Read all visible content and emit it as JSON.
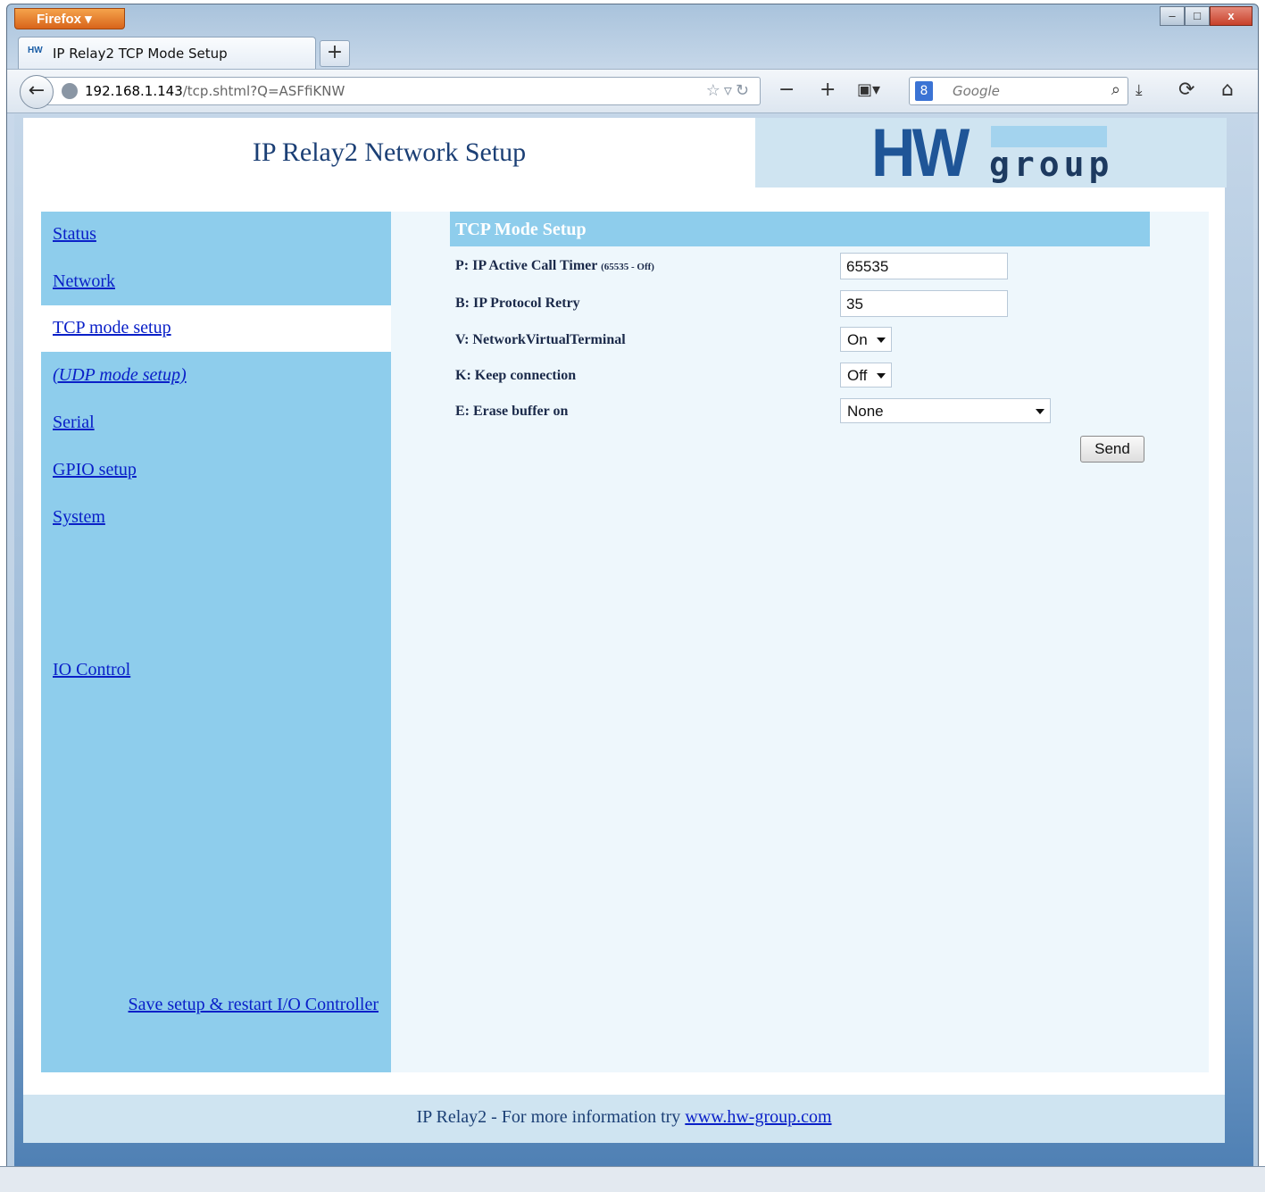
{
  "browser": {
    "app_button_label": "Firefox",
    "tab_title": "IP Relay2 TCP Mode Setup",
    "tab_icon_text": "HW",
    "new_tab_label": "+",
    "url_host": "192.168.1.143",
    "url_path": "/tcp.shtml?Q=ASFfiKNW",
    "search_placeholder": "Google",
    "window_controls": [
      "–",
      "□",
      "x"
    ]
  },
  "header": {
    "title": "IP Relay2 Network Setup",
    "logo_hw": "HW",
    "logo_group": "group"
  },
  "sidebar": {
    "items": [
      {
        "label": "Status"
      },
      {
        "label": "Network"
      },
      {
        "label": "TCP mode setup"
      },
      {
        "label": "(UDP mode setup)"
      },
      {
        "label": "Serial"
      },
      {
        "label": "GPIO setup"
      },
      {
        "label": "System"
      },
      {
        "label": "IO Control"
      }
    ],
    "save_link": "Save setup & restart I/O Controller"
  },
  "main": {
    "section_title": "TCP Mode Setup",
    "fields": [
      {
        "label": "P: IP Active Call Timer",
        "note": "(65535 - Off)",
        "value": "65535"
      },
      {
        "label": "B: IP Protocol Retry",
        "value": "35"
      },
      {
        "label": "V: NetworkVirtualTerminal",
        "value": "On"
      },
      {
        "label": "K: Keep connection",
        "value": "Off"
      },
      {
        "label": "E: Erase buffer on",
        "value": "None"
      }
    ],
    "send_label": "Send"
  },
  "footer": {
    "text": "IP Relay2 - For more information try ",
    "link": "www.hw-group.com"
  },
  "colors": {
    "sidebar_bg": "#8ecdec",
    "content_bg": "#eef7fc",
    "link": "#0a20c8",
    "header_text": "#1b3f75",
    "logo_blue": "#1f5597"
  },
  "icons": [
    "back-arrow-icon",
    "globe-icon",
    "bookmark-star-icon",
    "reload-icon",
    "zoom-out-icon",
    "zoom-in-icon",
    "bookmarks-menu-icon",
    "google-search-icon",
    "magnifier-icon",
    "download-icon",
    "sync-icon",
    "home-icon"
  ]
}
